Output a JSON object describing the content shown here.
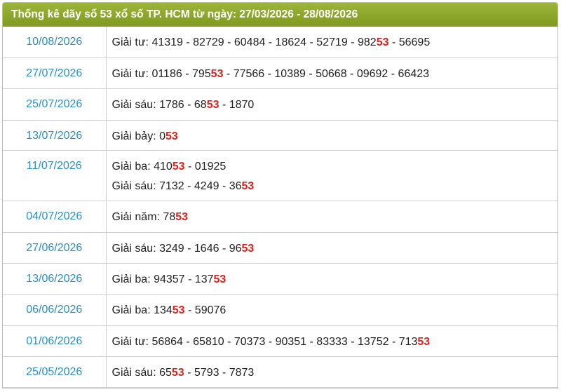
{
  "header": {
    "title": "Thống kê dãy số 53 xổ số TP. HCM từ ngày: 27/03/2026 - 28/08/2026"
  },
  "rows": [
    {
      "date": "10/08/2026",
      "height": 44,
      "lines": [
        {
          "prefix": "Giải tư: 41319 - 82729 - 60484 - 18624 - 52719 - 982",
          "hl": "53",
          "suffix": " - 56695"
        }
      ]
    },
    {
      "date": "27/07/2026",
      "height": 44,
      "lines": [
        {
          "prefix": "Giải tư: 01186 - 795",
          "hl": "53",
          "suffix": " - 77566 - 10389 - 50668 - 09692 - 66423"
        }
      ]
    },
    {
      "date": "25/07/2026",
      "height": 45,
      "lines": [
        {
          "prefix": "Giải sáu: 1786 - 68",
          "hl": "53",
          "suffix": " - 1870"
        }
      ]
    },
    {
      "date": "13/07/2026",
      "height": 43,
      "lines": [
        {
          "prefix": "Giải bảy: 0",
          "hl": "53",
          "suffix": ""
        }
      ]
    },
    {
      "date": "11/07/2026",
      "height": 72,
      "lines": [
        {
          "prefix": "Giải ba: 410",
          "hl": "53",
          "suffix": " - 01925"
        },
        {
          "prefix": "Giải sáu: 7132 - 4249 - 36",
          "hl": "53",
          "suffix": ""
        }
      ]
    },
    {
      "date": "04/07/2026",
      "height": 45,
      "lines": [
        {
          "prefix": "Giải năm: 78",
          "hl": "53",
          "suffix": ""
        }
      ]
    },
    {
      "date": "27/06/2026",
      "height": 44,
      "lines": [
        {
          "prefix": "Giải sáu: 3249 - 1646 - 96",
          "hl": "53",
          "suffix": ""
        }
      ]
    },
    {
      "date": "13/06/2026",
      "height": 44,
      "lines": [
        {
          "prefix": "Giải ba: 94357 - 137",
          "hl": "53",
          "suffix": ""
        }
      ]
    },
    {
      "date": "06/06/2026",
      "height": 45,
      "lines": [
        {
          "prefix": "Giải ba: 134",
          "hl": "53",
          "suffix": " - 59076"
        }
      ]
    },
    {
      "date": "01/06/2026",
      "height": 44,
      "lines": [
        {
          "prefix": "Giải tư: 56864 - 65810 - 70373 - 90351 - 83333 - 13752 - 713",
          "hl": "53",
          "suffix": ""
        }
      ]
    },
    {
      "date": "25/05/2026",
      "height": 44,
      "lines": [
        {
          "prefix": "Giải sáu: 65",
          "hl": "53",
          "suffix": " - 5793 - 7873"
        }
      ]
    }
  ]
}
